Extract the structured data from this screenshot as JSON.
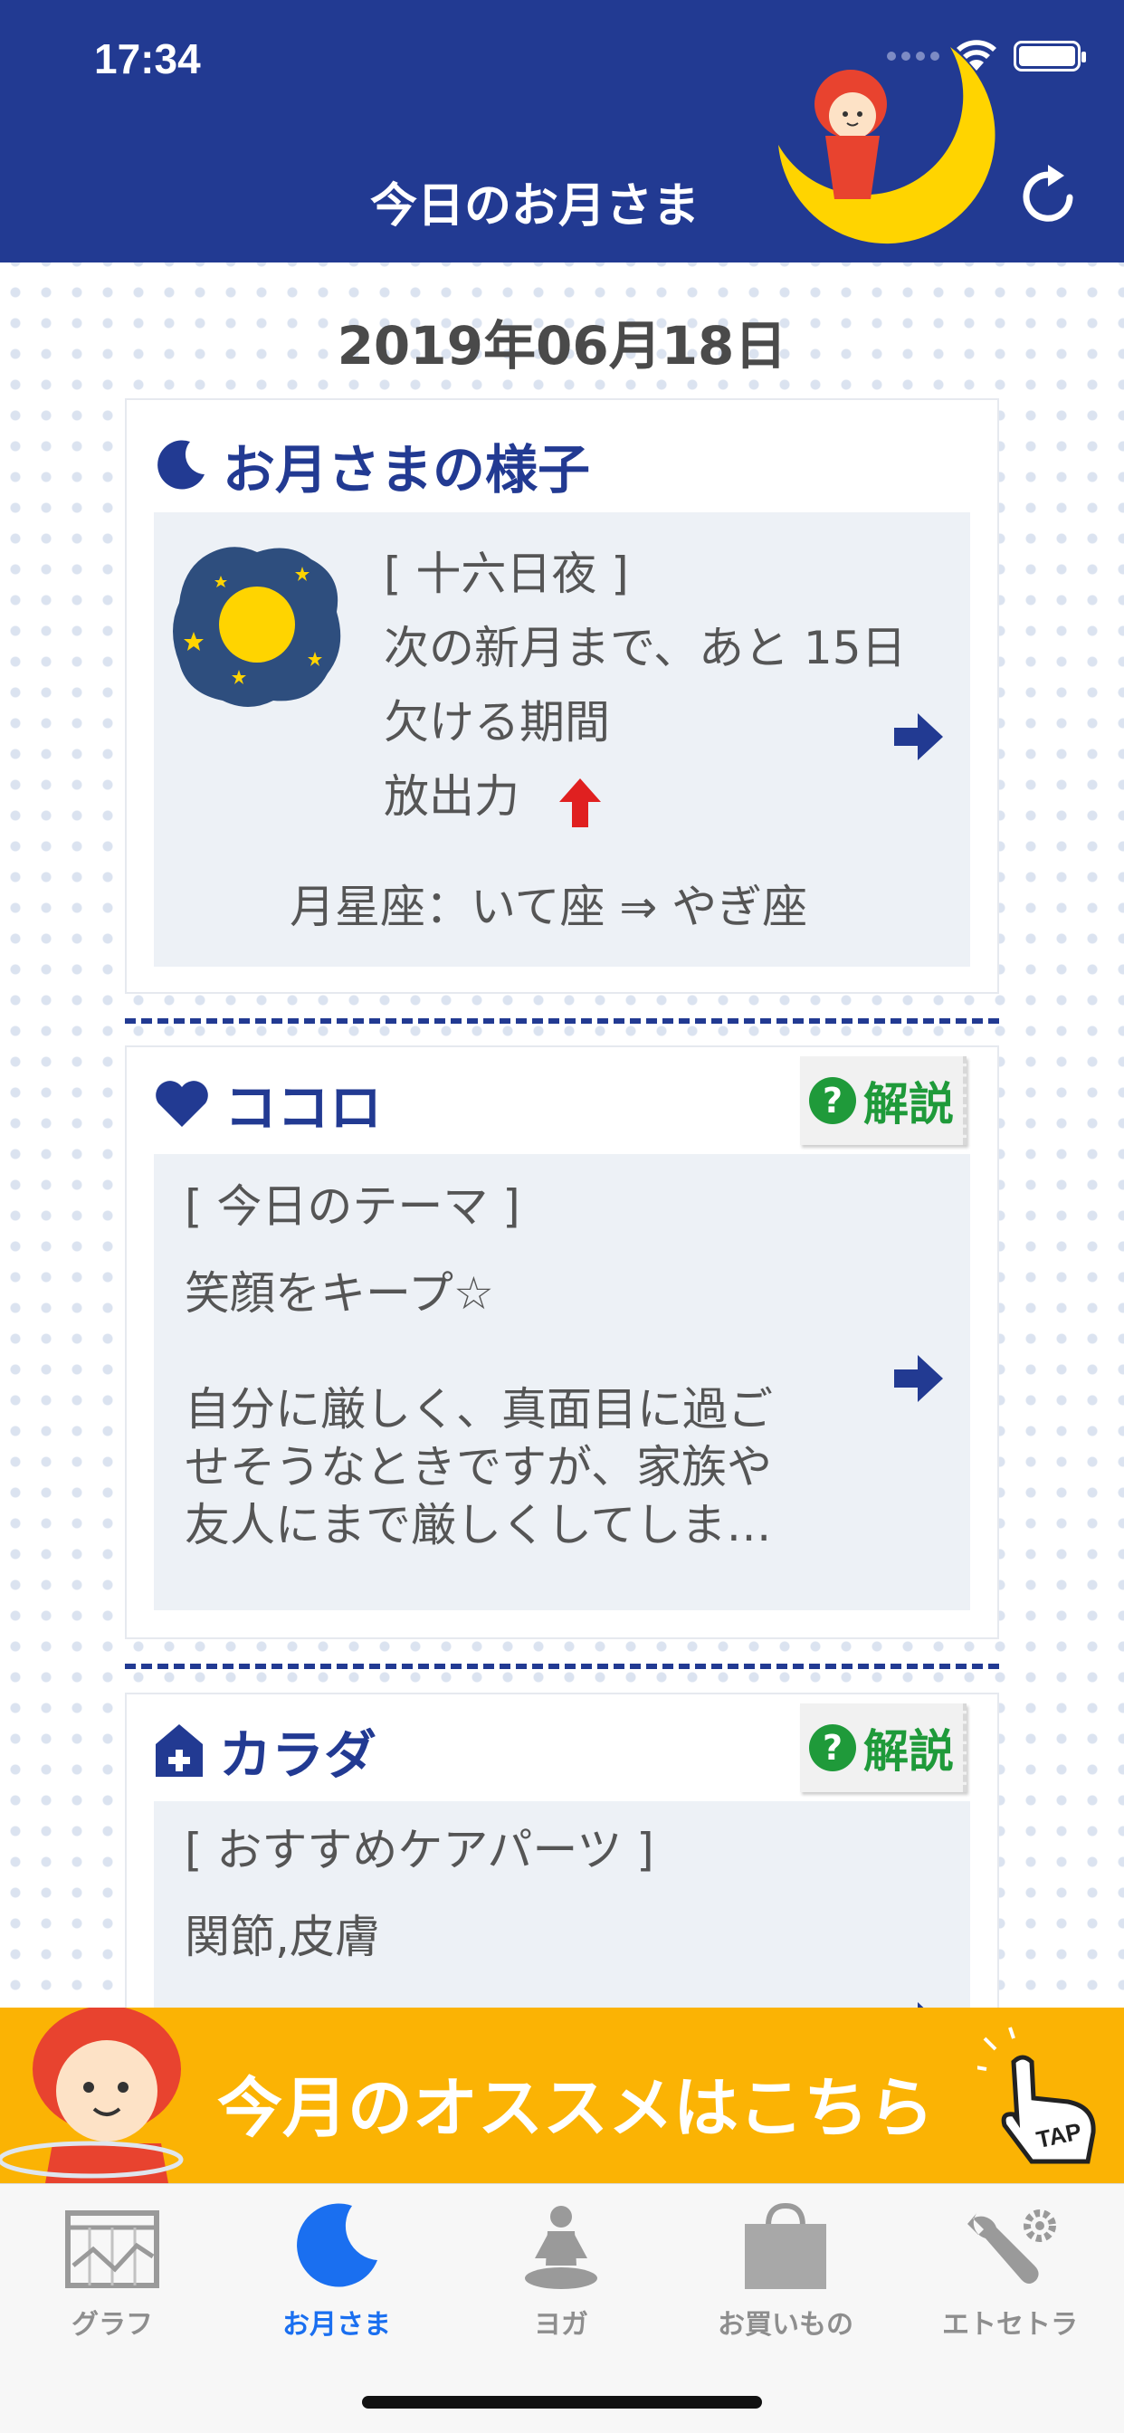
{
  "status_bar": {
    "time": "17:34"
  },
  "header": {
    "title": "今日のお月さま"
  },
  "date": "2019年06月18日",
  "moon_card": {
    "heading": "お月さまの様子",
    "phase": "[ 十六日夜 ]",
    "next_new_moon": "次の新月まで、あと 15日",
    "period": "欠ける期間",
    "power": "放出力",
    "moon_sign": "月星座：いて座 ⇒ やぎ座"
  },
  "kokoro_card": {
    "heading": "ココロ",
    "help_label": "解説",
    "theme_label": "[ 今日のテーマ ]",
    "theme": "笑顔をキープ☆",
    "description_lines": [
      "自分に厳しく、真面目に過ご",
      "せそうなときですが、家族や",
      "友人にまで厳しくしてしま…"
    ]
  },
  "karada_card": {
    "heading": "カラダ",
    "help_label": "解説",
    "parts_label": "[ おすすめケアパーツ ]",
    "parts": "関節,皮膚"
  },
  "banner": {
    "text": "今月のオススメはこちら",
    "tap_label": "TAP"
  },
  "tabs": [
    {
      "label": "グラフ",
      "icon": "graph-icon",
      "active": false
    },
    {
      "label": "お月さま",
      "icon": "moon-icon",
      "active": true
    },
    {
      "label": "ヨガ",
      "icon": "yoga-icon",
      "active": false
    },
    {
      "label": "お買いもの",
      "icon": "shopping-bag-icon",
      "active": false
    },
    {
      "label": "エトセトラ",
      "icon": "tools-icon",
      "active": false
    }
  ],
  "colors": {
    "header_bg": "#223a92",
    "accent_blue": "#223a92",
    "active_tab": "#1a6ff0",
    "banner_bg": "#fbb304",
    "help_green": "#1f9a3a",
    "power_arrow": "#e02020"
  }
}
